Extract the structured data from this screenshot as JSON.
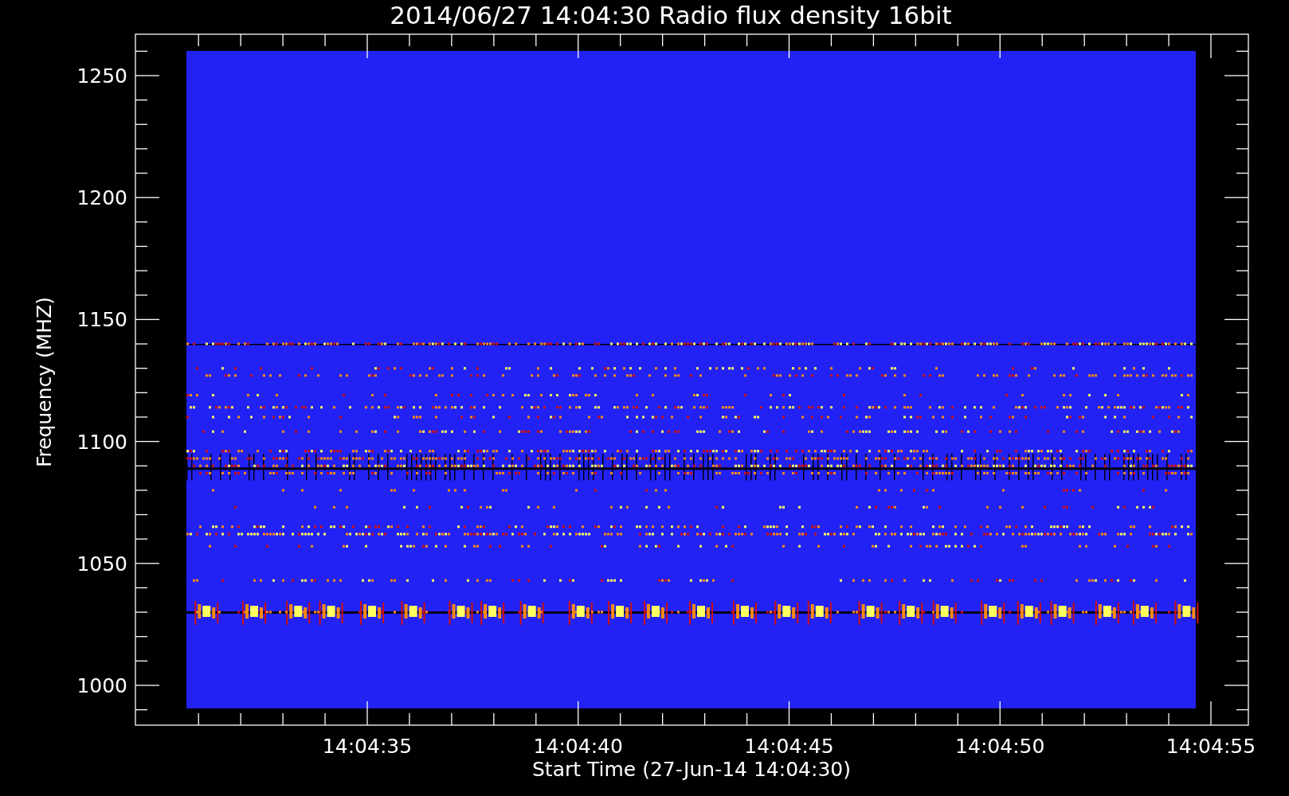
{
  "title": "2014/06/27 14:04:30 Radio flux density 16bit",
  "y_axis": {
    "label": "Frequency (MHZ)",
    "ticks": [
      "1250",
      "1200",
      "1150",
      "1100",
      "1050",
      "1000"
    ]
  },
  "x_axis": {
    "label": "Start Time (27-Jun-14 14:04:30)",
    "ticks": [
      "14:04:35",
      "14:04:40",
      "14:04:45",
      "14:04:50",
      "14:04:55"
    ]
  }
}
